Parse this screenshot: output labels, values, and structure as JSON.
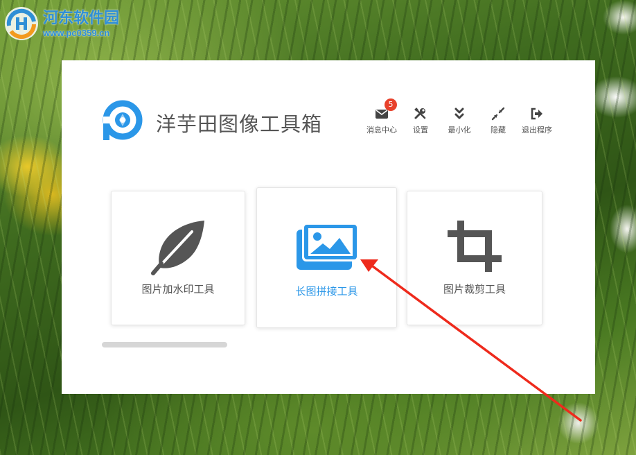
{
  "watermark": {
    "title": "河东软件园",
    "url": "www.pc0359.cn",
    "logo_icon": "hedong-logo-icon"
  },
  "app": {
    "title": "洋芋田图像工具箱",
    "logo_icon": "app-logo-icon",
    "accent_color": "#2b97e8"
  },
  "toolbar": {
    "messages": {
      "label": "消息中心",
      "badge": "5",
      "icon": "envelope-icon"
    },
    "settings": {
      "label": "设置",
      "icon": "wrench-screwdriver-icon"
    },
    "minimize": {
      "label": "最小化",
      "icon": "double-chevron-down-icon"
    },
    "hide": {
      "label": "隐藏",
      "icon": "compress-arrows-icon"
    },
    "exit": {
      "label": "退出程序",
      "icon": "sign-out-icon"
    }
  },
  "tools": [
    {
      "label": "图片加水印工具",
      "icon": "feather-icon",
      "active": false
    },
    {
      "label": "长图拼接工具",
      "icon": "images-icon",
      "active": true
    },
    {
      "label": "图片裁剪工具",
      "icon": "crop-icon",
      "active": false
    }
  ],
  "progress": {
    "value": 1.0
  },
  "annotation": {
    "color": "#ee2a1c",
    "icon": "red-arrow"
  }
}
